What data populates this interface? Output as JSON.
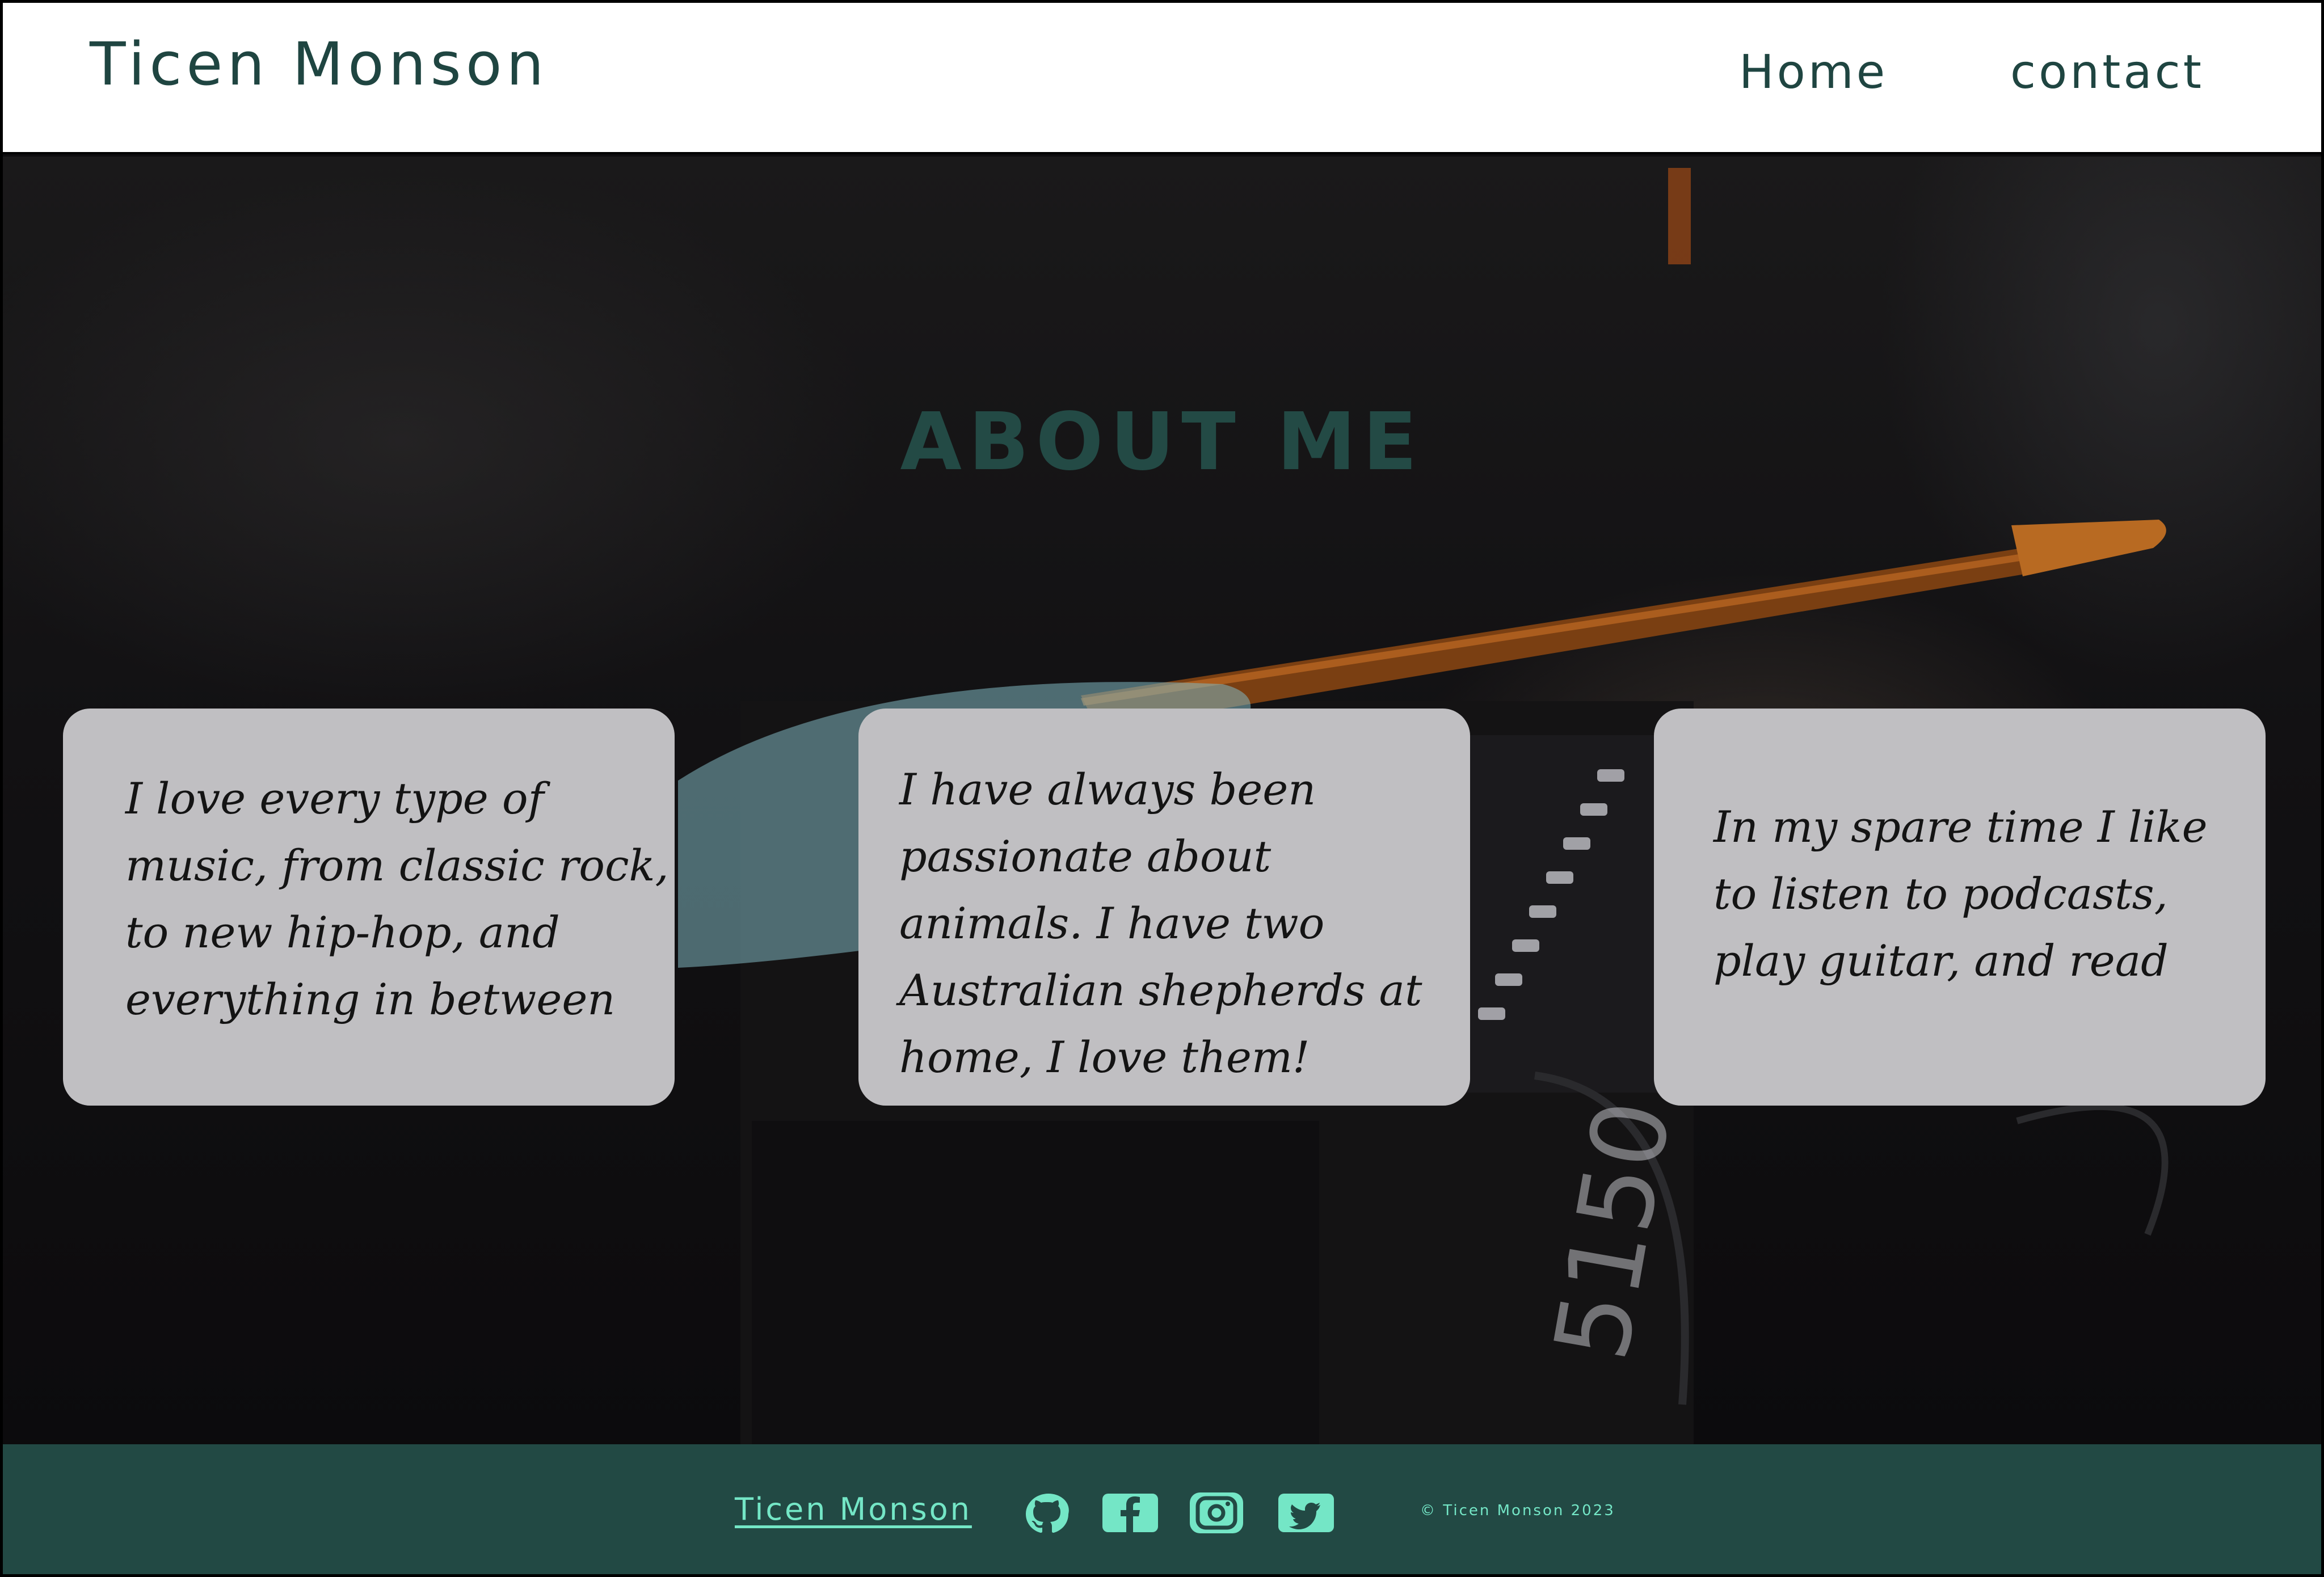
{
  "header": {
    "brand": "Ticen Monson",
    "nav": [
      {
        "label": "Home"
      },
      {
        "label": "contact"
      }
    ]
  },
  "main": {
    "title": "ABOUT ME",
    "cards": [
      {
        "text": "I love every type of music, from classic rock, to new hip-hop, and everything in between"
      },
      {
        "text": "I have always been passionate about animals. I have two Australian shepherds at home, I love them!"
      },
      {
        "text": "In my spare time I like to listen to podcasts, play guitar, and read"
      }
    ]
  },
  "footer": {
    "brand": "Ticen Monson",
    "social_icons": [
      "github-icon",
      "facebook-icon",
      "instagram-icon",
      "twitter-icon"
    ],
    "copyright": "© Ticen Monson 2023"
  },
  "colors": {
    "brand_dark_green": "#1f4541",
    "footer_bg": "#224944",
    "accent_mint": "#74e6c6",
    "card_bg": "#c0bfc2"
  }
}
